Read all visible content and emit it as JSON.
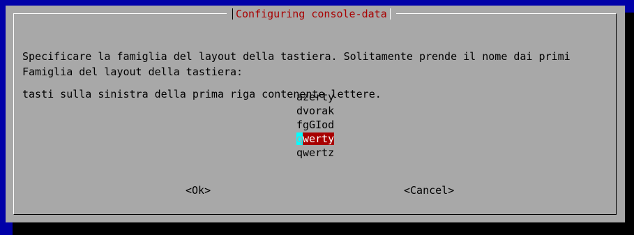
{
  "dialog": {
    "title": "Configuring console-data",
    "description_line1": "Specificare la famiglia del layout della tastiera. Solitamente prende il nome dai primi",
    "description_line2": "tasti sulla sinistra della prima riga contenente lettere.",
    "prompt": "Famiglia del layout della tastiera:",
    "options": [
      {
        "label": "azerty"
      },
      {
        "label": "dvorak"
      },
      {
        "label": "fgGIod"
      },
      {
        "label_first": "q",
        "label_rest": "werty",
        "selected": true
      },
      {
        "label": "qwertz"
      }
    ],
    "ok_label": "<Ok>",
    "cancel_label": "<Cancel>"
  },
  "colors": {
    "background": "#0000a8",
    "dialog": "#a8a8a8",
    "title": "#a80000",
    "selected_bg": "#a80000",
    "cursor": "#00ffff"
  }
}
